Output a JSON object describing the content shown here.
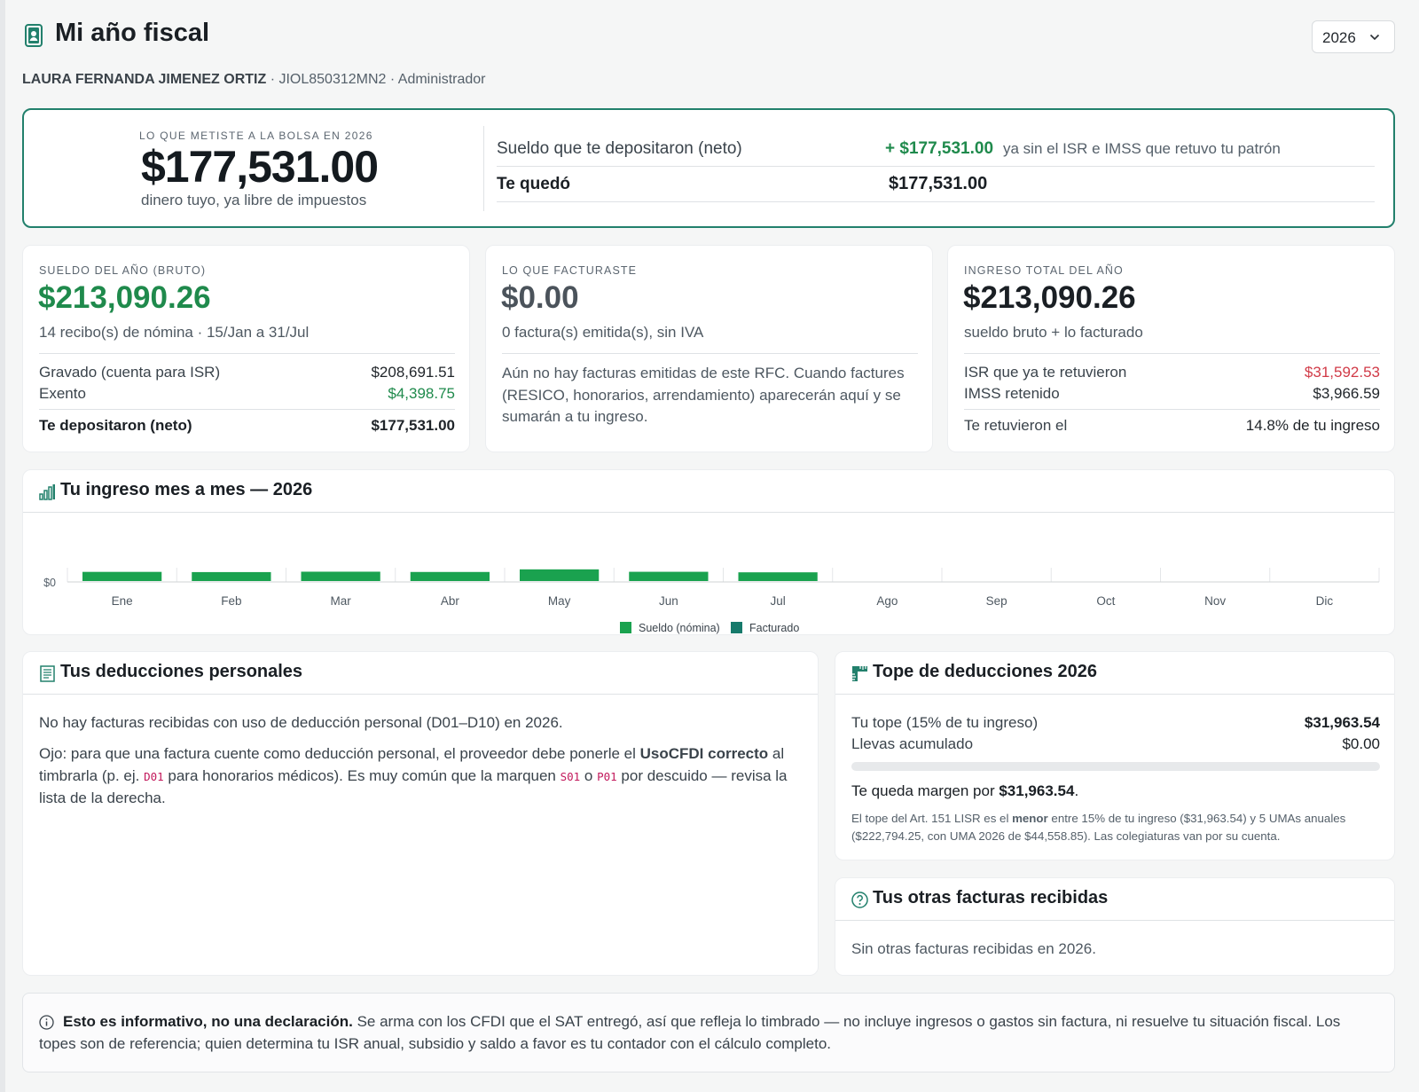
{
  "header": {
    "title": "Mi año fiscal",
    "year": "2026",
    "user_name": "LAURA FERNANDA JIMENEZ ORTIZ",
    "sep1": " · ",
    "rfc": "JIOL850312MN2",
    "sep2": " · ",
    "role": "Administrador"
  },
  "hero": {
    "caption": "LO QUE METISTE A LA BOLSA EN 2026",
    "amount": "$177,531.00",
    "sub": "dinero tuyo, ya libre de impuestos",
    "row1_label": "Sueldo que te depositaron (neto)",
    "row1_value": "+ $177,531.00",
    "row1_note": "ya sin el ISR e IMSS que retuvo tu patrón",
    "row2_label": "Te quedó",
    "row2_value": "$177,531.00"
  },
  "sueldo": {
    "caption": "SUELDO DEL AÑO (BRUTO)",
    "amount": "$213,090.26",
    "sub": "14 recibo(s) de nómina · 15/Jan a 31/Jul",
    "gravado_label": "Gravado (cuenta para ISR)",
    "gravado_value": "$208,691.51",
    "exento_label": "Exento",
    "exento_value": "$4,398.75",
    "neto_label": "Te depositaron (neto)",
    "neto_value": "$177,531.00"
  },
  "facturas": {
    "caption": "LO QUE FACTURASTE",
    "amount": "$0.00",
    "sub": "0 factura(s) emitida(s), sin IVA",
    "note": "Aún no hay facturas emitidas de este RFC. Cuando factures (RESICO, honorarios, arrendamiento) aparecerán aquí y se sumarán a tu ingreso."
  },
  "ingreso": {
    "caption": "INGRESO TOTAL DEL AÑO",
    "amount": "$213,090.26",
    "sub": "sueldo bruto + lo facturado",
    "isr_label": "ISR que ya te retuvieron",
    "isr_value": "$31,592.53",
    "imss_label": "IMSS retenido",
    "imss_value": "$3,966.59",
    "ret_label": "Te retuvieron el",
    "ret_value": "14.8% de tu ingreso"
  },
  "chart_data": {
    "type": "bar",
    "title": "Tu ingreso mes a mes — 2026",
    "categories": [
      "Ene",
      "Feb",
      "Mar",
      "Abr",
      "May",
      "Jun",
      "Jul",
      "Ago",
      "Sep",
      "Oct",
      "Nov",
      "Dic"
    ],
    "series": [
      {
        "name": "Sueldo (nómina)",
        "color": "#1aa24f",
        "values": [
          29500,
          28800,
          30100,
          29200,
          37600,
          29800,
          28090,
          0,
          0,
          0,
          0,
          0
        ]
      },
      {
        "name": "Facturado",
        "color": "#167a6b",
        "values": [
          0,
          0,
          0,
          0,
          0,
          0,
          0,
          0,
          0,
          0,
          0,
          0
        ]
      }
    ],
    "y_tick_labels": [
      "$0"
    ],
    "ylim": [
      0,
      300000
    ],
    "grid": true,
    "legend": "bottom-center"
  },
  "deducciones": {
    "title": "Tus deducciones personales",
    "p1": "No hay facturas recibidas con uso de deducción personal (D01–D10) en 2026.",
    "p2_a": "Ojo: para que una factura cuente como deducción personal, el proveedor debe ponerle el ",
    "p2_b": "UsoCFDI correcto",
    "p2_c": " al timbrarla (p. ej. ",
    "code1": "D01",
    "p2_d": " para honorarios médicos). Es muy común que la marquen ",
    "code2": "S01",
    "p2_e": " o ",
    "code3": "P01",
    "p2_f": " por descuido — revisa la lista de la derecha."
  },
  "tope": {
    "title": "Tope de deducciones 2026",
    "tope_label": "Tu tope (15% de tu ingreso)",
    "tope_value": "$31,963.54",
    "acum_label": "Llevas acumulado",
    "acum_value": "$0.00",
    "progress": 0,
    "margen_a": "Te queda margen por ",
    "margen_b": "$31,963.54",
    "margen_c": ".",
    "fine_a": "El tope del Art. 151 LISR es el ",
    "fine_b": "menor",
    "fine_c": " entre 15% de tu ingreso ($31,963.54) y 5 UMAs anuales ($222,794.25, con UMA 2026 de $44,558.85). Las colegiaturas van por su cuenta."
  },
  "otras": {
    "title": "Tus otras facturas recibidas",
    "text": "Sin otras facturas recibidas en 2026."
  },
  "info": {
    "bold": "Esto es informativo, no una declaración.",
    "text": " Se arma con los CFDI que el SAT entregó, así que refleja lo timbrado — no incluye ingresos o gastos sin factura, ni resuelve tu situación fiscal. Los topes son de referencia; quien determina tu ISR anual, subsidio y saldo a favor es tu contador con el cálculo completo."
  },
  "colors": {
    "accent": "#22806c",
    "positive": "#1f8a4c",
    "negative": "#d13a47"
  },
  "icons": [
    "id-badge-icon",
    "chevron-down-icon",
    "bar-chart-icon",
    "receipt-icon",
    "ruler-icon",
    "help-circle-icon",
    "info-icon"
  ]
}
